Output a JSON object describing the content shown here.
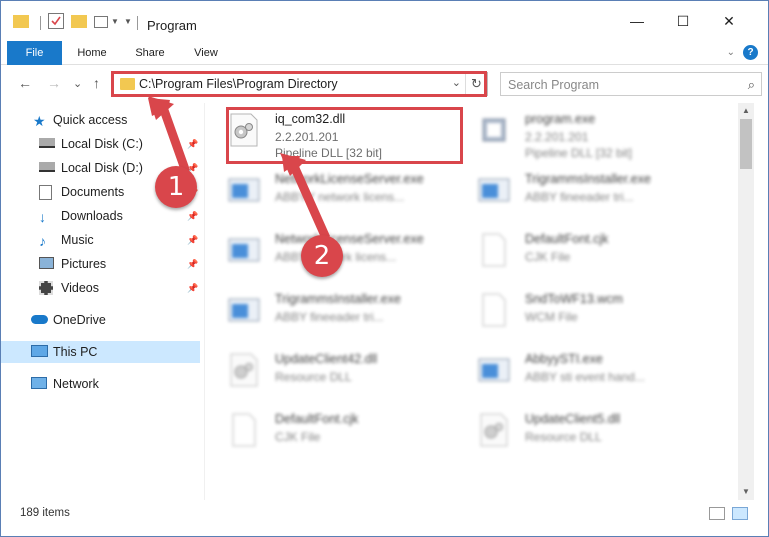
{
  "window": {
    "title": "Program",
    "controls": {
      "minimize": "—",
      "maximize": "☐",
      "close": "✕"
    }
  },
  "ribbon": {
    "tabs": [
      "File",
      "Home",
      "Share",
      "View"
    ],
    "help": "?"
  },
  "navigation": {
    "back": "←",
    "forward": "→",
    "recent": "⌄",
    "up": "↑",
    "address": "C:\\Program Files\\Program Directory",
    "search_placeholder": "Search Program"
  },
  "sidebar": {
    "items": [
      {
        "label": "Quick access",
        "icon": "star-icon",
        "pinned": false
      },
      {
        "label": "Local Disk (C:)",
        "icon": "drive-icon",
        "pinned": true
      },
      {
        "label": "Local Disk (D:)",
        "icon": "drive-icon",
        "pinned": true
      },
      {
        "label": "Documents",
        "icon": "documents-icon",
        "pinned": true
      },
      {
        "label": "Downloads",
        "icon": "download-icon",
        "pinned": true
      },
      {
        "label": "Music",
        "icon": "music-icon",
        "pinned": true
      },
      {
        "label": "Pictures",
        "icon": "pictures-icon",
        "pinned": true
      },
      {
        "label": "Videos",
        "icon": "videos-icon",
        "pinned": true
      },
      {
        "label": "OneDrive",
        "icon": "cloud-icon",
        "pinned": false
      },
      {
        "label": "This PC",
        "icon": "computer-icon",
        "pinned": false,
        "selected": true
      },
      {
        "label": "Network",
        "icon": "network-icon",
        "pinned": false
      }
    ]
  },
  "files": [
    {
      "name": "iq_com32.dll",
      "line2": "2.2.201.201",
      "line3": "Pipeline DLL [32 bit]",
      "icon": "dll-gear-icon",
      "highlighted": true
    },
    {
      "name": "program.exe",
      "line2": "2.2.201.201",
      "line3": "Pipeline DLL [32 bit]",
      "icon": "exe-icon"
    },
    {
      "name": "NetworkLicenseServer.exe",
      "line2": "ABBYY network licens...",
      "icon": "app-window-icon"
    },
    {
      "name": "TrigrammsInstaller.exe",
      "line2": "ABBY fineeader tri...",
      "icon": "app-window-icon"
    },
    {
      "name": "NetworkLicenseServer.exe",
      "line2": "ABBY network licens...",
      "icon": "app-window-icon"
    },
    {
      "name": "DefaultFont.cjk",
      "line2": "CJK File",
      "icon": "blank-file-icon"
    },
    {
      "name": "TrigrammsInstaller.exe",
      "line2": "ABBY fineeader tri...",
      "icon": "app-window-icon"
    },
    {
      "name": "SndToWF13.wcm",
      "line2": "WCM File",
      "icon": "blank-file-icon"
    },
    {
      "name": "UpdateClient42.dll",
      "line2": "Resource DLL",
      "icon": "dll-gear-icon"
    },
    {
      "name": "AbbyySTI.exe",
      "line2": "ABBY sti event hand...",
      "icon": "app-window-icon"
    },
    {
      "name": "DefaultFont.cjk",
      "line2": "CJK File",
      "icon": "blank-file-icon"
    },
    {
      "name": "UpdateClient5.dll",
      "line2": "Resource DLL",
      "icon": "dll-gear-icon"
    }
  ],
  "status": {
    "item_count": "189 items"
  },
  "annotations": {
    "step1": "1",
    "step2": "2"
  },
  "colors": {
    "accent": "#1979ca",
    "highlight": "#d9464b",
    "selected": "#cce8ff",
    "folder": "#f2c851"
  }
}
